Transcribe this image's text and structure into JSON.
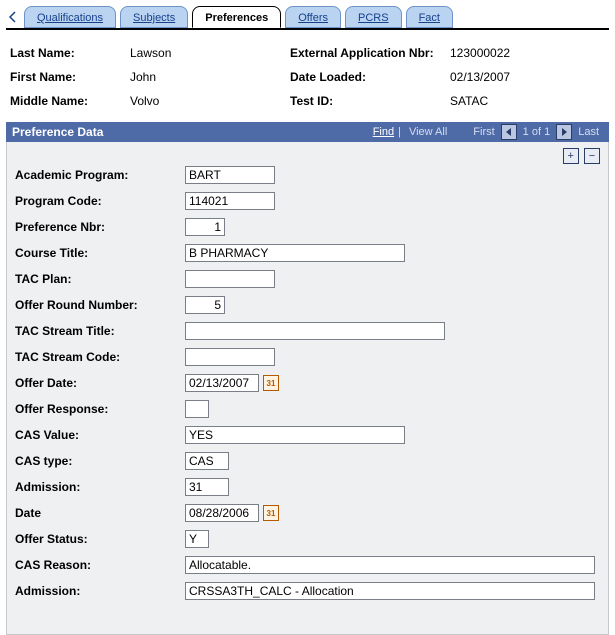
{
  "tabs": [
    "Qualifications",
    "Subjects",
    "Preferences",
    "Offers",
    "PCRS",
    "Fact"
  ],
  "active_tab_index": 2,
  "header": {
    "last_name_label": "Last Name:",
    "last_name": "Lawson",
    "first_name_label": "First Name:",
    "first_name": "John",
    "middle_name_label": "Middle Name:",
    "middle_name": "Volvo",
    "ext_app_nbr_label": "External Application Nbr:",
    "ext_app_nbr": "123000022",
    "date_loaded_label": "Date Loaded:",
    "date_loaded": "02/13/2007",
    "test_id_label": "Test ID:",
    "test_id": "SATAC"
  },
  "section": {
    "title": "Preference Data",
    "nav": {
      "find": "Find",
      "view_all": "View All",
      "first": "First",
      "position": "1 of 1",
      "last": "Last"
    }
  },
  "calendar_day": "31",
  "form": {
    "academic_program": {
      "label": "Academic Program:",
      "value": "BART"
    },
    "program_code": {
      "label": "Program Code:",
      "value": "114021"
    },
    "preference_nbr": {
      "label": "Preference Nbr:",
      "value": "1"
    },
    "course_title": {
      "label": "Course Title:",
      "value": "B PHARMACY"
    },
    "tac_plan": {
      "label": "TAC Plan:",
      "value": ""
    },
    "offer_round_nbr": {
      "label": "Offer Round Number:",
      "value": "5"
    },
    "tac_stream_title": {
      "label": "TAC Stream Title:",
      "value": ""
    },
    "tac_stream_code": {
      "label": "TAC Stream Code:",
      "value": ""
    },
    "offer_date": {
      "label": "Offer Date:",
      "value": "02/13/2007"
    },
    "offer_response": {
      "label": "Offer Response:",
      "value": ""
    },
    "cas_value": {
      "label": "CAS Value:",
      "value": "YES"
    },
    "cas_type": {
      "label": "CAS type:",
      "value": "CAS"
    },
    "admission1": {
      "label": "Admission:",
      "value": "31"
    },
    "date": {
      "label": "Date",
      "value": "08/28/2006"
    },
    "offer_status": {
      "label": "Offer Status:",
      "value": "Y"
    },
    "cas_reason": {
      "label": "CAS Reason:",
      "value": "Allocatable."
    },
    "admission2": {
      "label": "Admission:",
      "value": "CRSSA3TH_CALC - Allocation"
    }
  }
}
